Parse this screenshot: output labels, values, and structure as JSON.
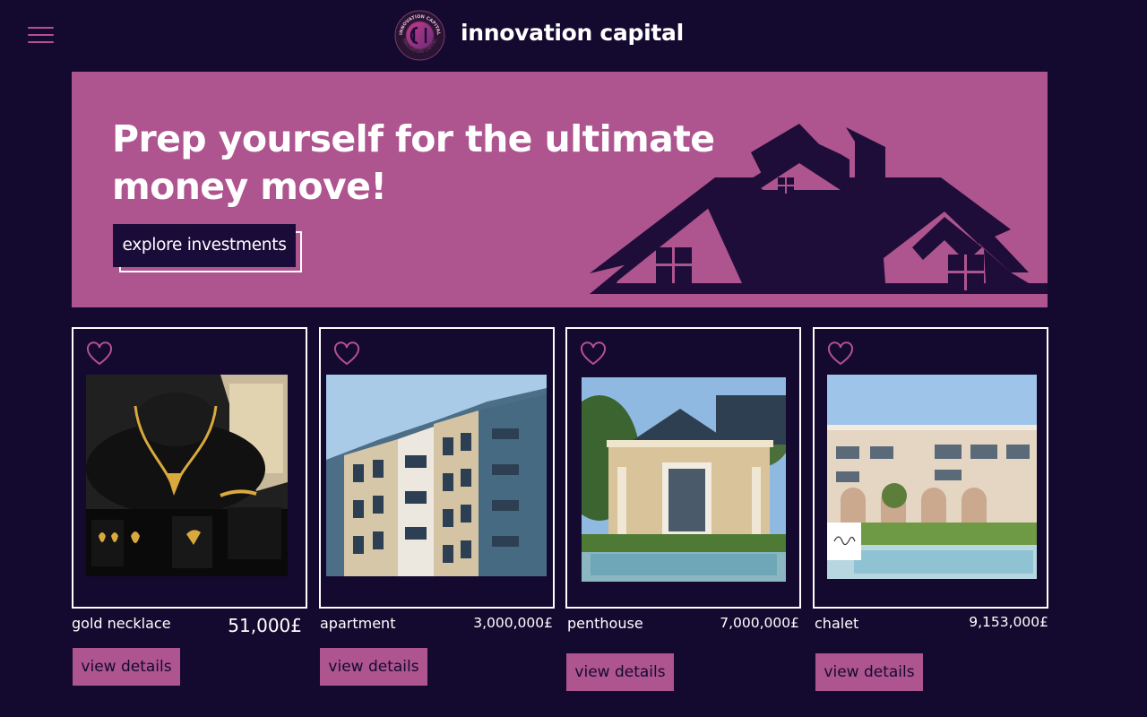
{
  "header": {
    "brand": "innovation capital",
    "logo_text": "INNOVATION CAPITAL"
  },
  "hero": {
    "title": "Prep yourself for the ultimate money move!",
    "cta_label": "explore investments"
  },
  "listings": [
    {
      "name": "gold necklace",
      "price": "51,000£",
      "button": "view details"
    },
    {
      "name": "apartment",
      "price": "3,000,000£",
      "button": "view details"
    },
    {
      "name": "penthouse",
      "price": "7,000,000£",
      "button": "view details"
    },
    {
      "name": "chalet",
      "price": "9,153,000£",
      "button": "view details"
    }
  ],
  "colors": {
    "background": "#140a30",
    "accent": "#ae548f",
    "text": "#ffffff"
  },
  "icons": {
    "menu": "hamburger-menu-icon",
    "favorite": "heart-outline-icon",
    "logo": "ic-circle-logo",
    "hero_art": "house-roof-silhouette"
  }
}
